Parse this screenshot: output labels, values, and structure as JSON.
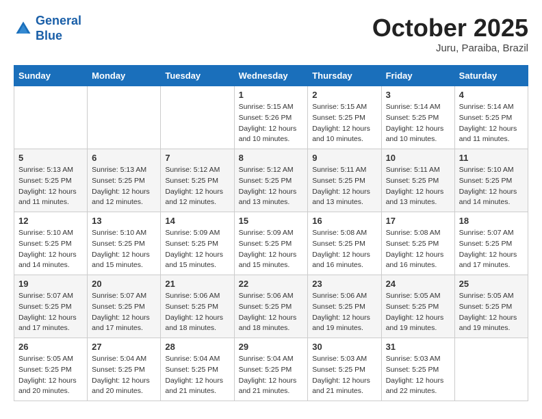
{
  "header": {
    "logo_line1": "General",
    "logo_line2": "Blue",
    "month": "October 2025",
    "location": "Juru, Paraiba, Brazil"
  },
  "weekdays": [
    "Sunday",
    "Monday",
    "Tuesday",
    "Wednesday",
    "Thursday",
    "Friday",
    "Saturday"
  ],
  "weeks": [
    [
      {
        "day": "",
        "info": ""
      },
      {
        "day": "",
        "info": ""
      },
      {
        "day": "",
        "info": ""
      },
      {
        "day": "1",
        "info": "Sunrise: 5:15 AM\nSunset: 5:26 PM\nDaylight: 12 hours\nand 10 minutes."
      },
      {
        "day": "2",
        "info": "Sunrise: 5:15 AM\nSunset: 5:25 PM\nDaylight: 12 hours\nand 10 minutes."
      },
      {
        "day": "3",
        "info": "Sunrise: 5:14 AM\nSunset: 5:25 PM\nDaylight: 12 hours\nand 10 minutes."
      },
      {
        "day": "4",
        "info": "Sunrise: 5:14 AM\nSunset: 5:25 PM\nDaylight: 12 hours\nand 11 minutes."
      }
    ],
    [
      {
        "day": "5",
        "info": "Sunrise: 5:13 AM\nSunset: 5:25 PM\nDaylight: 12 hours\nand 11 minutes."
      },
      {
        "day": "6",
        "info": "Sunrise: 5:13 AM\nSunset: 5:25 PM\nDaylight: 12 hours\nand 12 minutes."
      },
      {
        "day": "7",
        "info": "Sunrise: 5:12 AM\nSunset: 5:25 PM\nDaylight: 12 hours\nand 12 minutes."
      },
      {
        "day": "8",
        "info": "Sunrise: 5:12 AM\nSunset: 5:25 PM\nDaylight: 12 hours\nand 13 minutes."
      },
      {
        "day": "9",
        "info": "Sunrise: 5:11 AM\nSunset: 5:25 PM\nDaylight: 12 hours\nand 13 minutes."
      },
      {
        "day": "10",
        "info": "Sunrise: 5:11 AM\nSunset: 5:25 PM\nDaylight: 12 hours\nand 13 minutes."
      },
      {
        "day": "11",
        "info": "Sunrise: 5:10 AM\nSunset: 5:25 PM\nDaylight: 12 hours\nand 14 minutes."
      }
    ],
    [
      {
        "day": "12",
        "info": "Sunrise: 5:10 AM\nSunset: 5:25 PM\nDaylight: 12 hours\nand 14 minutes."
      },
      {
        "day": "13",
        "info": "Sunrise: 5:10 AM\nSunset: 5:25 PM\nDaylight: 12 hours\nand 15 minutes."
      },
      {
        "day": "14",
        "info": "Sunrise: 5:09 AM\nSunset: 5:25 PM\nDaylight: 12 hours\nand 15 minutes."
      },
      {
        "day": "15",
        "info": "Sunrise: 5:09 AM\nSunset: 5:25 PM\nDaylight: 12 hours\nand 15 minutes."
      },
      {
        "day": "16",
        "info": "Sunrise: 5:08 AM\nSunset: 5:25 PM\nDaylight: 12 hours\nand 16 minutes."
      },
      {
        "day": "17",
        "info": "Sunrise: 5:08 AM\nSunset: 5:25 PM\nDaylight: 12 hours\nand 16 minutes."
      },
      {
        "day": "18",
        "info": "Sunrise: 5:07 AM\nSunset: 5:25 PM\nDaylight: 12 hours\nand 17 minutes."
      }
    ],
    [
      {
        "day": "19",
        "info": "Sunrise: 5:07 AM\nSunset: 5:25 PM\nDaylight: 12 hours\nand 17 minutes."
      },
      {
        "day": "20",
        "info": "Sunrise: 5:07 AM\nSunset: 5:25 PM\nDaylight: 12 hours\nand 17 minutes."
      },
      {
        "day": "21",
        "info": "Sunrise: 5:06 AM\nSunset: 5:25 PM\nDaylight: 12 hours\nand 18 minutes."
      },
      {
        "day": "22",
        "info": "Sunrise: 5:06 AM\nSunset: 5:25 PM\nDaylight: 12 hours\nand 18 minutes."
      },
      {
        "day": "23",
        "info": "Sunrise: 5:06 AM\nSunset: 5:25 PM\nDaylight: 12 hours\nand 19 minutes."
      },
      {
        "day": "24",
        "info": "Sunrise: 5:05 AM\nSunset: 5:25 PM\nDaylight: 12 hours\nand 19 minutes."
      },
      {
        "day": "25",
        "info": "Sunrise: 5:05 AM\nSunset: 5:25 PM\nDaylight: 12 hours\nand 19 minutes."
      }
    ],
    [
      {
        "day": "26",
        "info": "Sunrise: 5:05 AM\nSunset: 5:25 PM\nDaylight: 12 hours\nand 20 minutes."
      },
      {
        "day": "27",
        "info": "Sunrise: 5:04 AM\nSunset: 5:25 PM\nDaylight: 12 hours\nand 20 minutes."
      },
      {
        "day": "28",
        "info": "Sunrise: 5:04 AM\nSunset: 5:25 PM\nDaylight: 12 hours\nand 21 minutes."
      },
      {
        "day": "29",
        "info": "Sunrise: 5:04 AM\nSunset: 5:25 PM\nDaylight: 12 hours\nand 21 minutes."
      },
      {
        "day": "30",
        "info": "Sunrise: 5:03 AM\nSunset: 5:25 PM\nDaylight: 12 hours\nand 21 minutes."
      },
      {
        "day": "31",
        "info": "Sunrise: 5:03 AM\nSunset: 5:25 PM\nDaylight: 12 hours\nand 22 minutes."
      },
      {
        "day": "",
        "info": ""
      }
    ]
  ]
}
